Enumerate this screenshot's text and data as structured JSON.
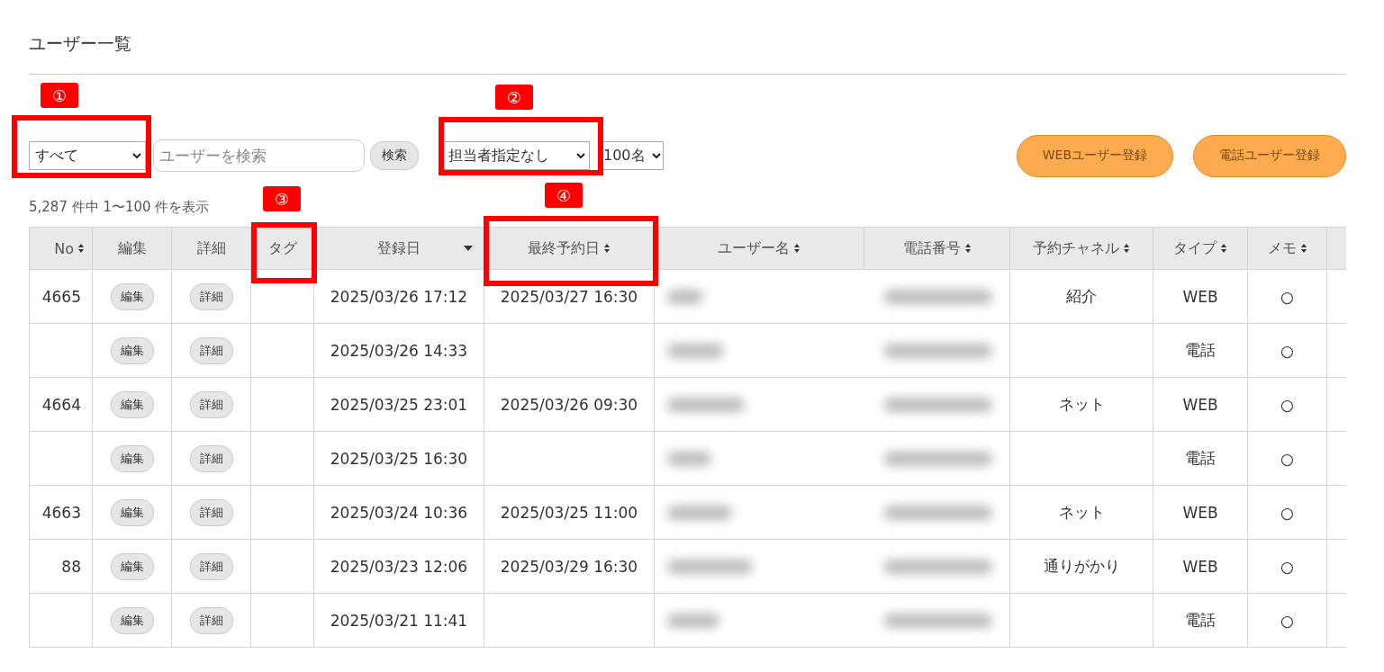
{
  "title": "ユーザー一覧",
  "filter": {
    "value": "すべて"
  },
  "search": {
    "placeholder": "ユーザーを検索",
    "button": "検索"
  },
  "staff_select": {
    "value": "担当者指定なし"
  },
  "per_page": {
    "value": "100名"
  },
  "actions": [
    "WEBユーザー登録",
    "電話ユーザー登録"
  ],
  "count": "5,287 件中 1〜100 件を表示",
  "columns": [
    {
      "label": "No",
      "sortable": true,
      "sorted": false
    },
    {
      "label": "編集",
      "sortable": false,
      "sorted": false
    },
    {
      "label": "詳細",
      "sortable": false,
      "sorted": false
    },
    {
      "label": "タグ",
      "sortable": false,
      "sorted": false
    },
    {
      "label": "登録日",
      "sortable": true,
      "sorted": true
    },
    {
      "label": "最終予約日",
      "sortable": true,
      "sorted": false
    },
    {
      "label": "ユーザー名",
      "sortable": true,
      "sorted": false
    },
    {
      "label": "電話番号",
      "sortable": true,
      "sorted": false
    },
    {
      "label": "予約チャネル",
      "sortable": true,
      "sorted": false
    },
    {
      "label": "タイプ",
      "sortable": true,
      "sorted": false
    },
    {
      "label": "メモ",
      "sortable": true,
      "sorted": false
    }
  ],
  "rows": [
    {
      "no": "4665",
      "edit": "編集",
      "detail": "詳細",
      "registered": "2025/03/26 17:12",
      "last_booking": "2025/03/27 16:30",
      "channel": "紹介",
      "type": "WEB",
      "memo": "○"
    },
    {
      "edit": "編集",
      "detail": "詳細",
      "registered": "2025/03/26 14:33",
      "type": "電話",
      "memo": "○"
    },
    {
      "no": "4664",
      "edit": "編集",
      "detail": "詳細",
      "registered": "2025/03/25 23:01",
      "last_booking": "2025/03/26 09:30",
      "channel": "ネット",
      "type": "WEB",
      "memo": "○"
    },
    {
      "edit": "編集",
      "detail": "詳細",
      "registered": "2025/03/25 16:30",
      "type": "電話",
      "memo": "○"
    },
    {
      "no": "4663",
      "edit": "編集",
      "detail": "詳細",
      "registered": "2025/03/24 10:36",
      "last_booking": "2025/03/25 11:00",
      "channel": "ネット",
      "type": "WEB",
      "memo": "○"
    },
    {
      "no": "88",
      "edit": "編集",
      "detail": "詳細",
      "registered": "2025/03/23 12:06",
      "last_booking": "2025/03/29 16:30",
      "channel": "通りがかり",
      "type": "WEB",
      "memo": "○"
    },
    {
      "edit": "編集",
      "detail": "詳細",
      "registered": "2025/03/21 11:41",
      "type": "電話",
      "memo": "○"
    }
  ],
  "annotations": [
    {
      "label": "①"
    },
    {
      "label": "②"
    },
    {
      "label": "③"
    },
    {
      "label": "④"
    }
  ]
}
